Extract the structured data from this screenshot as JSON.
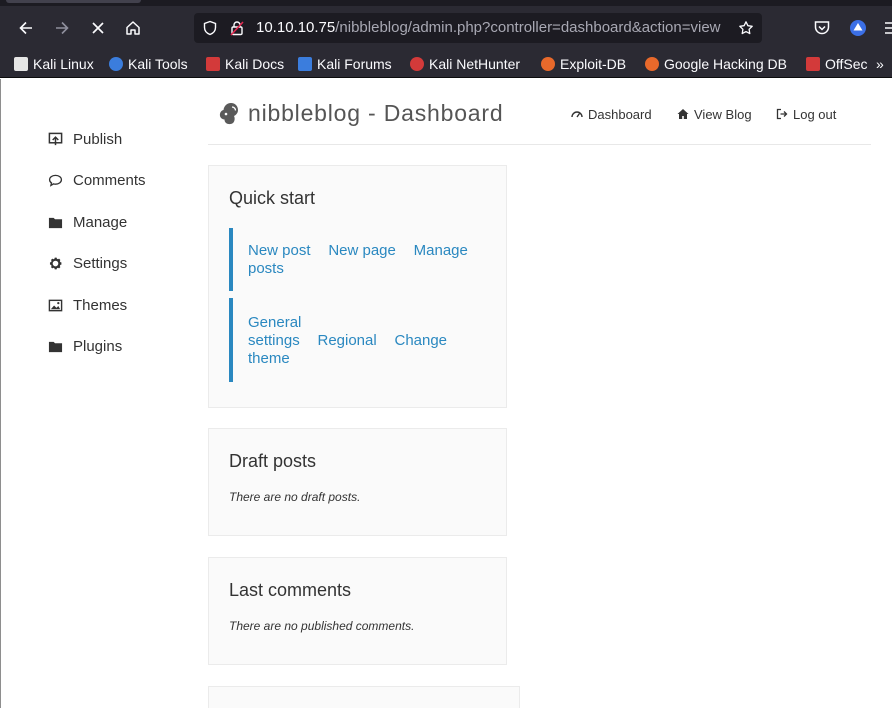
{
  "browser": {
    "url_host": "10.10.10.75",
    "url_path": "/nibbleblog/admin.php?controller=dashboard&action=view",
    "bookmarks": [
      {
        "label": "Kali Linux",
        "icon": "kali-dragon-icon",
        "color": "#e6e6e6"
      },
      {
        "label": "Kali Tools",
        "icon": "kali-tools-icon",
        "color": "#3b7ddd"
      },
      {
        "label": "Kali Docs",
        "icon": "kali-docs-icon",
        "color": "#d33a3a"
      },
      {
        "label": "Kali Forums",
        "icon": "kali-forums-icon",
        "color": "#3b7ddd"
      },
      {
        "label": "Kali NetHunter",
        "icon": "nethunter-icon",
        "color": "#d33a3a"
      },
      {
        "label": "Exploit-DB",
        "icon": "exploit-db-icon",
        "color": "#e8692b"
      },
      {
        "label": "Google Hacking DB",
        "icon": "ghdb-icon",
        "color": "#e8692b"
      },
      {
        "label": "OffSec",
        "icon": "offsec-icon",
        "color": "#d33a3a"
      }
    ]
  },
  "sidebar": {
    "items": [
      {
        "label": "Publish",
        "icon": "publish-icon"
      },
      {
        "label": "Comments",
        "icon": "comment-icon"
      },
      {
        "label": "Manage",
        "icon": "folder-icon"
      },
      {
        "label": "Settings",
        "icon": "gear-icon"
      },
      {
        "label": "Themes",
        "icon": "image-icon"
      },
      {
        "label": "Plugins",
        "icon": "folder-icon"
      }
    ]
  },
  "header": {
    "title": "nibbleblog - Dashboard",
    "nav": [
      {
        "label": "Dashboard",
        "icon": "gauge-icon"
      },
      {
        "label": "View Blog",
        "icon": "home-icon"
      },
      {
        "label": "Log out",
        "icon": "logout-icon"
      }
    ]
  },
  "quick_start": {
    "title": "Quick start",
    "group1": [
      "New post",
      "New page",
      "Manage posts"
    ],
    "group2": [
      "General settings",
      "Regional",
      "Change theme"
    ]
  },
  "draft_posts": {
    "title": "Draft posts",
    "note": "There are no draft posts."
  },
  "last_comments": {
    "title": "Last comments",
    "note": "There are no published comments."
  },
  "colors": {
    "link": "#2a88c0",
    "accent_bar": "#2a88c0",
    "chrome": "#2b2a33"
  }
}
